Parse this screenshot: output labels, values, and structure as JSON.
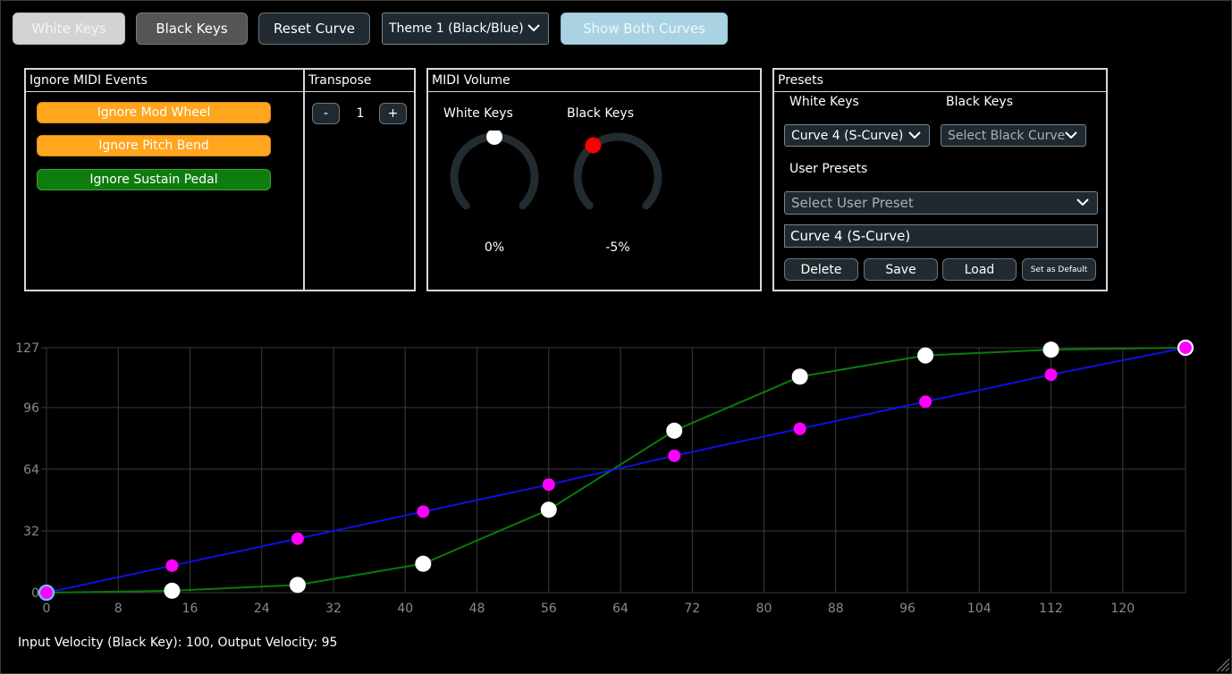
{
  "toolbar": {
    "white_keys": "White Keys",
    "black_keys": "Black Keys",
    "reset_curve": "Reset Curve",
    "theme": "Theme 1 (Black/Blue)",
    "show_both": "Show Both Curves"
  },
  "ignore_midi": {
    "title": "Ignore MIDI Events",
    "items": [
      {
        "label": "Ignore Mod Wheel",
        "state": "orange"
      },
      {
        "label": "Ignore Pitch Bend",
        "state": "orange"
      },
      {
        "label": "Ignore Sustain Pedal",
        "state": "green"
      }
    ]
  },
  "transpose": {
    "title": "Transpose",
    "minus": "-",
    "value": "1",
    "plus": "+"
  },
  "midi_volume": {
    "title": "MIDI Volume",
    "white": {
      "label": "White Keys",
      "value": "0%",
      "level": 0.5,
      "color": "#ffffff"
    },
    "black": {
      "label": "Black Keys",
      "value": "-5%",
      "level": 0.36,
      "color": "#ff0000"
    }
  },
  "presets": {
    "title": "Presets",
    "white_label": "White Keys",
    "black_label": "Black Keys",
    "white_selected": "Curve 4 (S-Curve)",
    "black_placeholder": "Select Black Curve",
    "user_label": "User Presets",
    "user_placeholder": "Select User Preset",
    "name_value": "Curve 4 (S-Curve)",
    "delete": "Delete",
    "save": "Save",
    "load": "Load",
    "set_default": "Set as Default"
  },
  "chart_data": {
    "type": "line",
    "xlim": [
      0,
      127
    ],
    "ylim": [
      0,
      127
    ],
    "x_ticks": [
      0,
      8,
      16,
      24,
      32,
      40,
      48,
      56,
      64,
      72,
      80,
      88,
      96,
      104,
      112,
      120
    ],
    "y_ticks": [
      0,
      32,
      64,
      96,
      127
    ],
    "grid": true,
    "series": [
      {
        "color": "#0a7a0a",
        "marker": "#ffffff",
        "x": [
          0,
          14,
          28,
          42,
          56,
          70,
          84,
          98,
          112,
          127
        ],
        "y": [
          0,
          1,
          4,
          15,
          43,
          84,
          112,
          123,
          126,
          127
        ]
      },
      {
        "color": "#1010e0",
        "marker": "#ff00ff",
        "x": [
          0,
          14,
          28,
          42,
          56,
          70,
          84,
          98,
          112,
          127
        ],
        "y": [
          0,
          14,
          28,
          42,
          56,
          71,
          85,
          99,
          113,
          127
        ]
      }
    ]
  },
  "status": "Input Velocity (Black Key): 100, Output Velocity: 95"
}
